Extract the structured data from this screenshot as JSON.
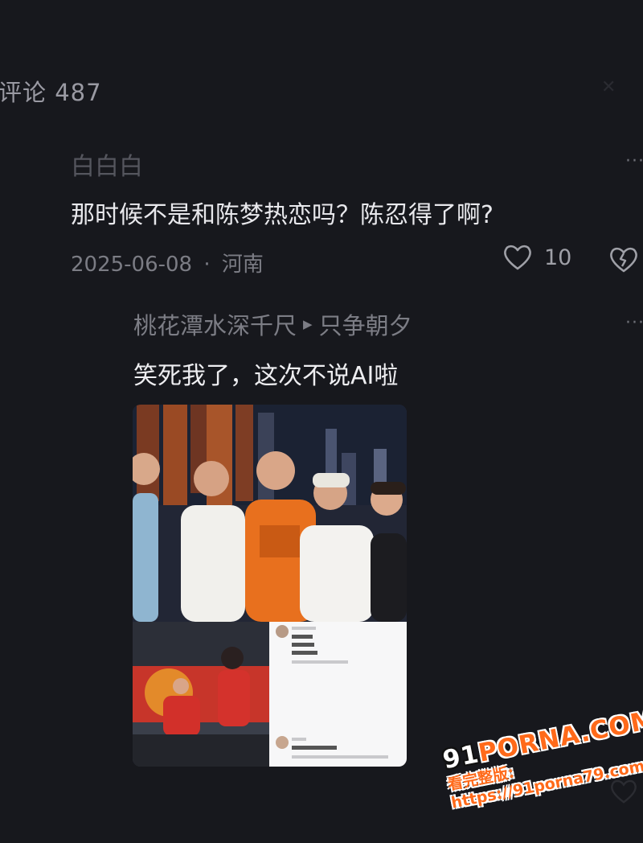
{
  "header": {
    "title": "评论 487"
  },
  "comment": {
    "username": "白白白",
    "text": "那时候不是和陈梦热恋吗？陈忍得了啊?",
    "date": "2025-06-08",
    "separator": "·",
    "location": "河南",
    "likes": "10",
    "more_label": "···"
  },
  "reply": {
    "username": "桃花潭水深千尺",
    "reply_to": "只争朝夕",
    "text": "笑死我了，这次不说AI啦",
    "more_label": "···"
  },
  "watermark": {
    "logo_prefix": "91",
    "logo_main": "PORNA.COM",
    "url": "看完整版: https://91porna79.com"
  },
  "colors": {
    "background": "#17181d",
    "watermark_orange": "#ff6a1a",
    "shirt_orange": "#e8701e"
  },
  "icons": [
    "heart-icon",
    "broken-heart-icon",
    "more-icon",
    "reply-arrow-icon"
  ]
}
